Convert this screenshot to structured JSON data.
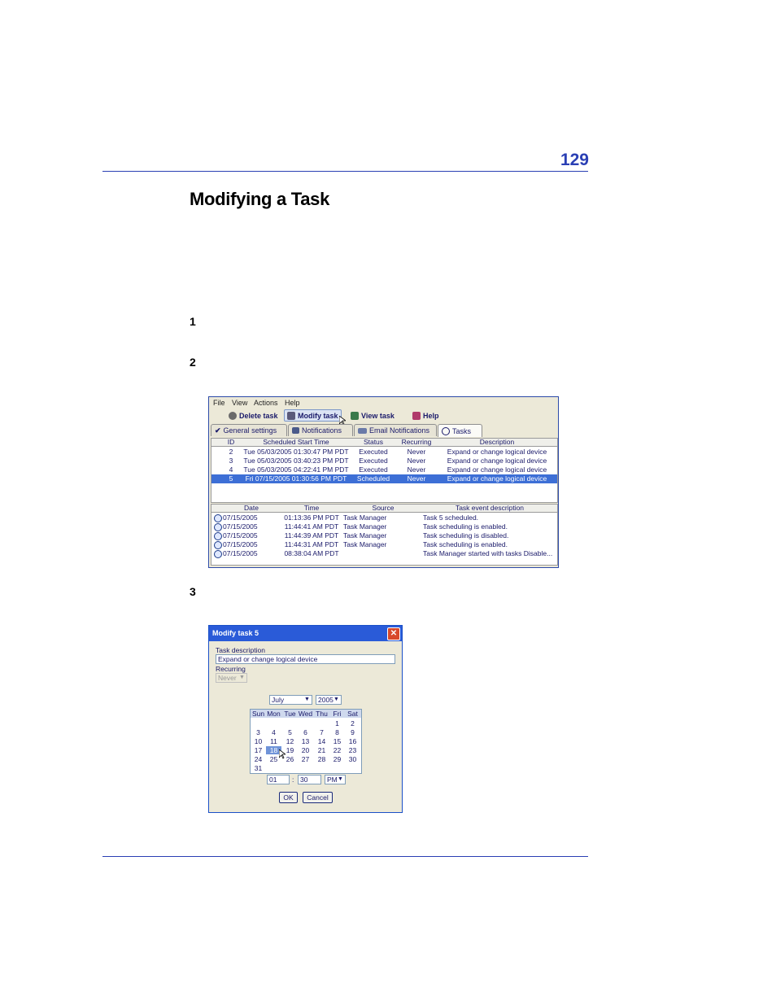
{
  "page": {
    "number": "129",
    "title": "Modifying a Task"
  },
  "steps": [
    "1",
    "2",
    "3"
  ],
  "task_window": {
    "menu": [
      "File",
      "View",
      "Actions",
      "Help"
    ],
    "toolbar": {
      "delete": "Delete task",
      "modify": "Modify task",
      "view": "View task",
      "help": "Help"
    },
    "tabs": [
      "General settings",
      "Notifications",
      "Email Notifications",
      "Tasks"
    ],
    "task_table": {
      "columns": [
        "ID",
        "Scheduled Start Time",
        "Status",
        "Recurring",
        "Description"
      ],
      "rows": [
        [
          "2",
          "Tue 05/03/2005 01:30:47 PM PDT",
          "Executed",
          "Never",
          "Expand or change logical device"
        ],
        [
          "3",
          "Tue 05/03/2005 03:40:23 PM PDT",
          "Executed",
          "Never",
          "Expand or change logical device"
        ],
        [
          "4",
          "Tue 05/03/2005 04:22:41 PM PDT",
          "Executed",
          "Never",
          "Expand or change logical device"
        ],
        [
          "5",
          "Fri 07/15/2005 01:30:56 PM PDT",
          "Scheduled",
          "Never",
          "Expand or change logical device"
        ]
      ]
    },
    "event_table": {
      "columns": [
        "Date",
        "Time",
        "Source",
        "Task event description"
      ],
      "rows": [
        [
          "07/15/2005",
          "01:13:36 PM PDT",
          "Task Manager",
          "Task 5 scheduled."
        ],
        [
          "07/15/2005",
          "11:44:41 AM PDT",
          "Task Manager",
          "Task scheduling is enabled."
        ],
        [
          "07/15/2005",
          "11:44:39 AM PDT",
          "Task Manager",
          "Task scheduling is disabled."
        ],
        [
          "07/15/2005",
          "11:44:31 AM PDT",
          "Task Manager",
          "Task scheduling is enabled."
        ],
        [
          "07/15/2005",
          "08:38:04 AM PDT",
          "",
          "Task Manager started with tasks Disable..."
        ]
      ]
    }
  },
  "modify_dialog": {
    "title": "Modify task 5",
    "close": "✕",
    "description_label": "Task description",
    "description_value": "Expand or change logical device",
    "recurring_label": "Recurring",
    "recurring_value": "Never",
    "month": "July",
    "year": "2005",
    "weekdays": [
      "Sun",
      "Mon",
      "Tue",
      "Wed",
      "Thu",
      "Fri",
      "Sat"
    ],
    "weeks": [
      [
        "",
        "",
        "",
        "",
        "",
        "1",
        "2"
      ],
      [
        "3",
        "4",
        "5",
        "6",
        "7",
        "8",
        "9"
      ],
      [
        "10",
        "11",
        "12",
        "13",
        "14",
        "15",
        "16"
      ],
      [
        "17",
        "18",
        "19",
        "20",
        "21",
        "22",
        "23"
      ],
      [
        "24",
        "25",
        "26",
        "27",
        "28",
        "29",
        "30"
      ],
      [
        "31",
        "",
        "",
        "",
        "",
        "",
        ""
      ]
    ],
    "selected_day": "18",
    "hour": "01",
    "separator": ":",
    "minute": "30",
    "ampm": "PM",
    "ok": "OK",
    "cancel": "Cancel"
  },
  "colors": {
    "accent": "#2a3fb4",
    "selection": "#3d6fd6",
    "titlebar": "#2a5bd8"
  }
}
